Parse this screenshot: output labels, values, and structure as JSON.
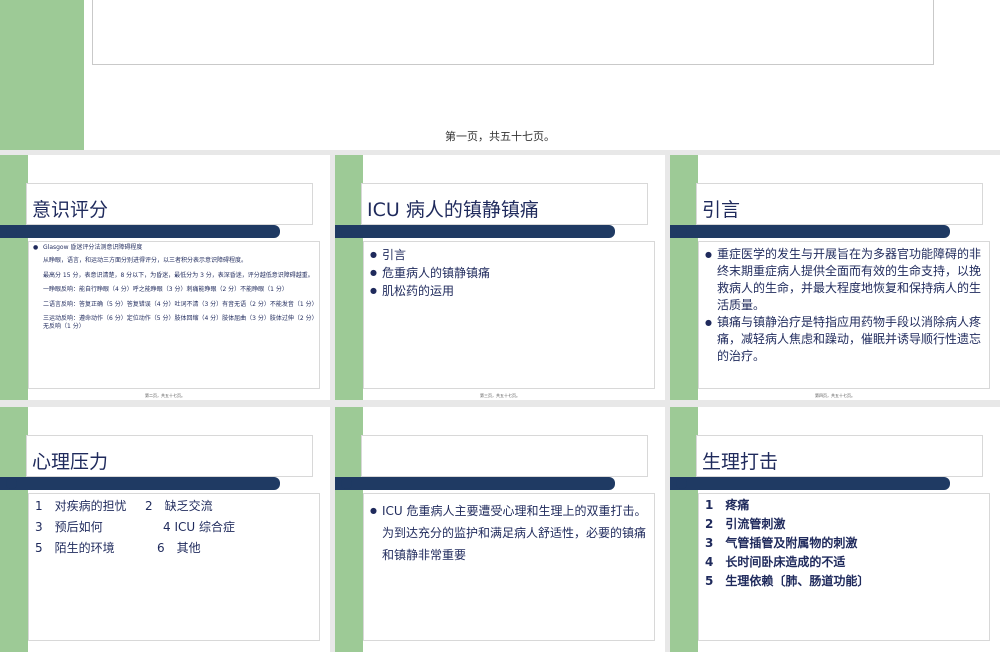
{
  "top_slide": {
    "footer": "第一页，共五十七页。"
  },
  "slides": [
    {
      "title": "意识评分",
      "bullet": "Glasgow 昏迷评分法测意识障碍程度",
      "paras": [
        "从睁眼，语言，和运动三方面分别进得评分，以三者积分表示意识障碍程度。",
        "最高分 15 分，表意识清楚，8 分以下，为昏迷，最低分为 3 分，表深昏迷，评分越低意识障碍越重。",
        "一睁眼反响：能自行睁眼（4 分）呼之能睁眼（3 分）刺痛能睁眼（2 分）不能睁眼（1 分）",
        "二语言反响：答复正确（5 分）答复错误（4 分）吐词不清（3 分）有音无语（2 分）不能发音（1 分）",
        "三运动反响：遵命动作（6 分）定位动作（5 分）肢体回缩（4 分）肢体屈曲（3 分）肢体过伸（2 分）无反响（1 分）"
      ],
      "footer": "第二页，共五十七页。"
    },
    {
      "title": "ICU 病人的镇静镇痛",
      "items": [
        "引言",
        "危重病人的镇静镇痛",
        "肌松药的运用"
      ],
      "footer": "第三页，共五十七页。"
    },
    {
      "title": "引言",
      "items": [
        "重症医学的发生与开展旨在为多器官功能障碍的非终末期重症病人提供全面而有效的生命支持，以挽救病人的生命，并最大程度地恢复和保持病人的生活质量。",
        "镇痛与镇静治疗是特指应用药物手段以消除病人疼痛，减轻病人焦虑和躁动，催眠并诱导顺行性遗忘的治疗。"
      ],
      "footer": "第四页，共五十七页。"
    },
    {
      "title": "心理压力",
      "rows": [
        [
          "1　对疾病的担忧",
          "2　缺乏交流"
        ],
        [
          "3　预后如何",
          "4  ICU 综合症"
        ],
        [
          "5　陌生的环境",
          "6　其他"
        ]
      ]
    },
    {
      "title": "",
      "text": "ICU 危重病人主要遭受心理和生理上的双重打击。为到达充分的监护和满足病人舒适性，必要的镇痛和镇静非常重要"
    },
    {
      "title": "生理打击",
      "items": [
        "1　疼痛",
        "2　引流管刺激",
        "3　气管插管及附属物的刺激",
        "4　长时间卧床造成的不适",
        "5　生理依赖〔肺、肠道功能〕"
      ]
    }
  ]
}
